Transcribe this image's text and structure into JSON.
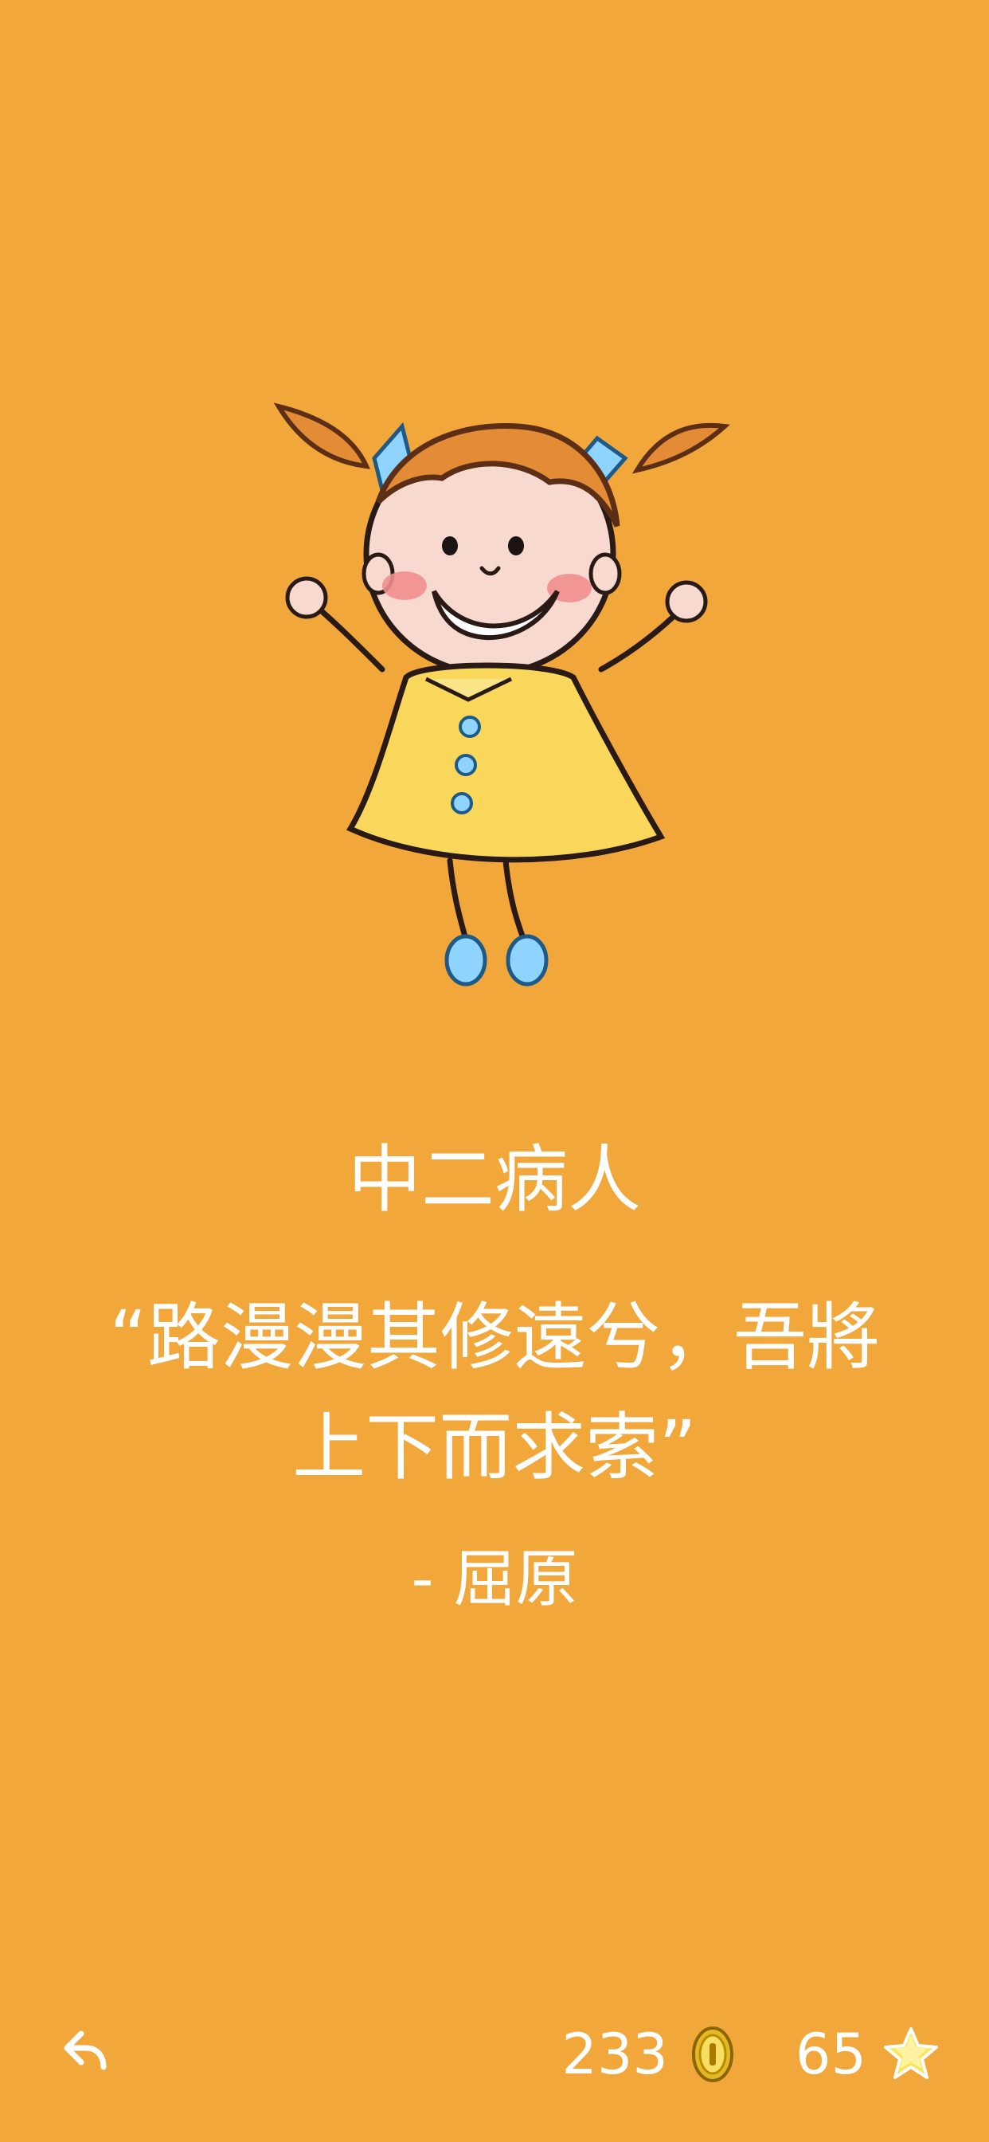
{
  "screen": {
    "title": "中二病人",
    "quote": "“路漫漫其修遠兮，吾將上下而求索”",
    "author": "- 屈原"
  },
  "footer": {
    "back_icon": "reply-arrow-icon",
    "coins": "233",
    "coin_icon": "coin-icon",
    "stars": "65",
    "star_icon": "star-icon"
  },
  "colors": {
    "background": "#F2A73B",
    "text": "#FFFFFF",
    "coin": "#F2D35C",
    "star": "#F7E55C"
  }
}
